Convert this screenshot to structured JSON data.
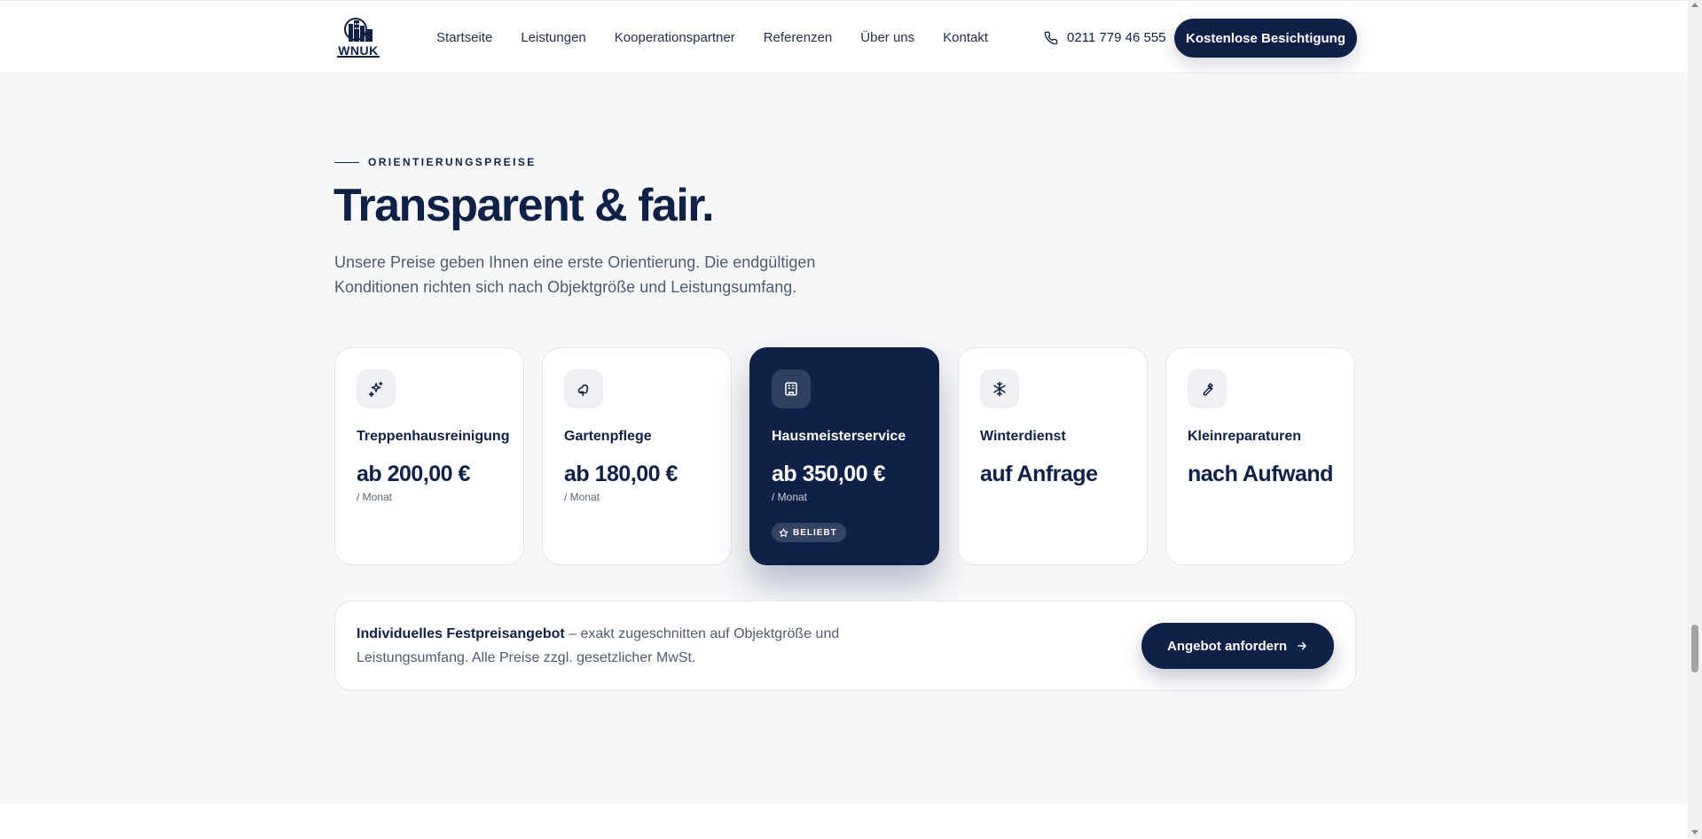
{
  "header": {
    "logo_text": "WNUK",
    "nav": [
      "Startseite",
      "Leistungen",
      "Kooperationspartner",
      "Referenzen",
      "Über uns",
      "Kontakt"
    ],
    "phone": "0211 779 46 555",
    "cta": "Kostenlose Besichtigung"
  },
  "section": {
    "eyebrow": "ORIENTIERUNGSPREISE",
    "title": "Transparent & fair.",
    "lead": "Unsere Preise geben Ihnen eine erste Orientierung. Die endgültigen Konditionen richten sich nach Objektgröße und Leistungsumfang."
  },
  "cards": [
    {
      "icon": "sparkle-icon",
      "title": "Treppenhausreinigung",
      "price": "ab 200,00 €",
      "unit": "/ Monat"
    },
    {
      "icon": "tree-icon",
      "title": "Gartenpflege",
      "price": "ab 180,00 €",
      "unit": "/ Monat"
    },
    {
      "icon": "building-icon",
      "title": "Hausmeisterservice",
      "price": "ab 350,00 €",
      "unit": "/ Monat",
      "badge": "BELIEBT"
    },
    {
      "icon": "snowflake-icon",
      "title": "Winterdienst",
      "price": "auf Anfrage"
    },
    {
      "icon": "wrench-icon",
      "title": "Kleinreparaturen",
      "price": "nach Aufwand"
    }
  ],
  "offer": {
    "strong": "Individuelles Festpreisangebot",
    "text": " – exakt zugeschnitten auf Objektgröße und Leistungsumfang. Alle Preise zzgl. gesetzlicher MwSt.",
    "button": "Angebot anfordern"
  },
  "colors": {
    "brand": "#0f2147",
    "background": "#f7f8fa",
    "card": "#ffffff"
  }
}
